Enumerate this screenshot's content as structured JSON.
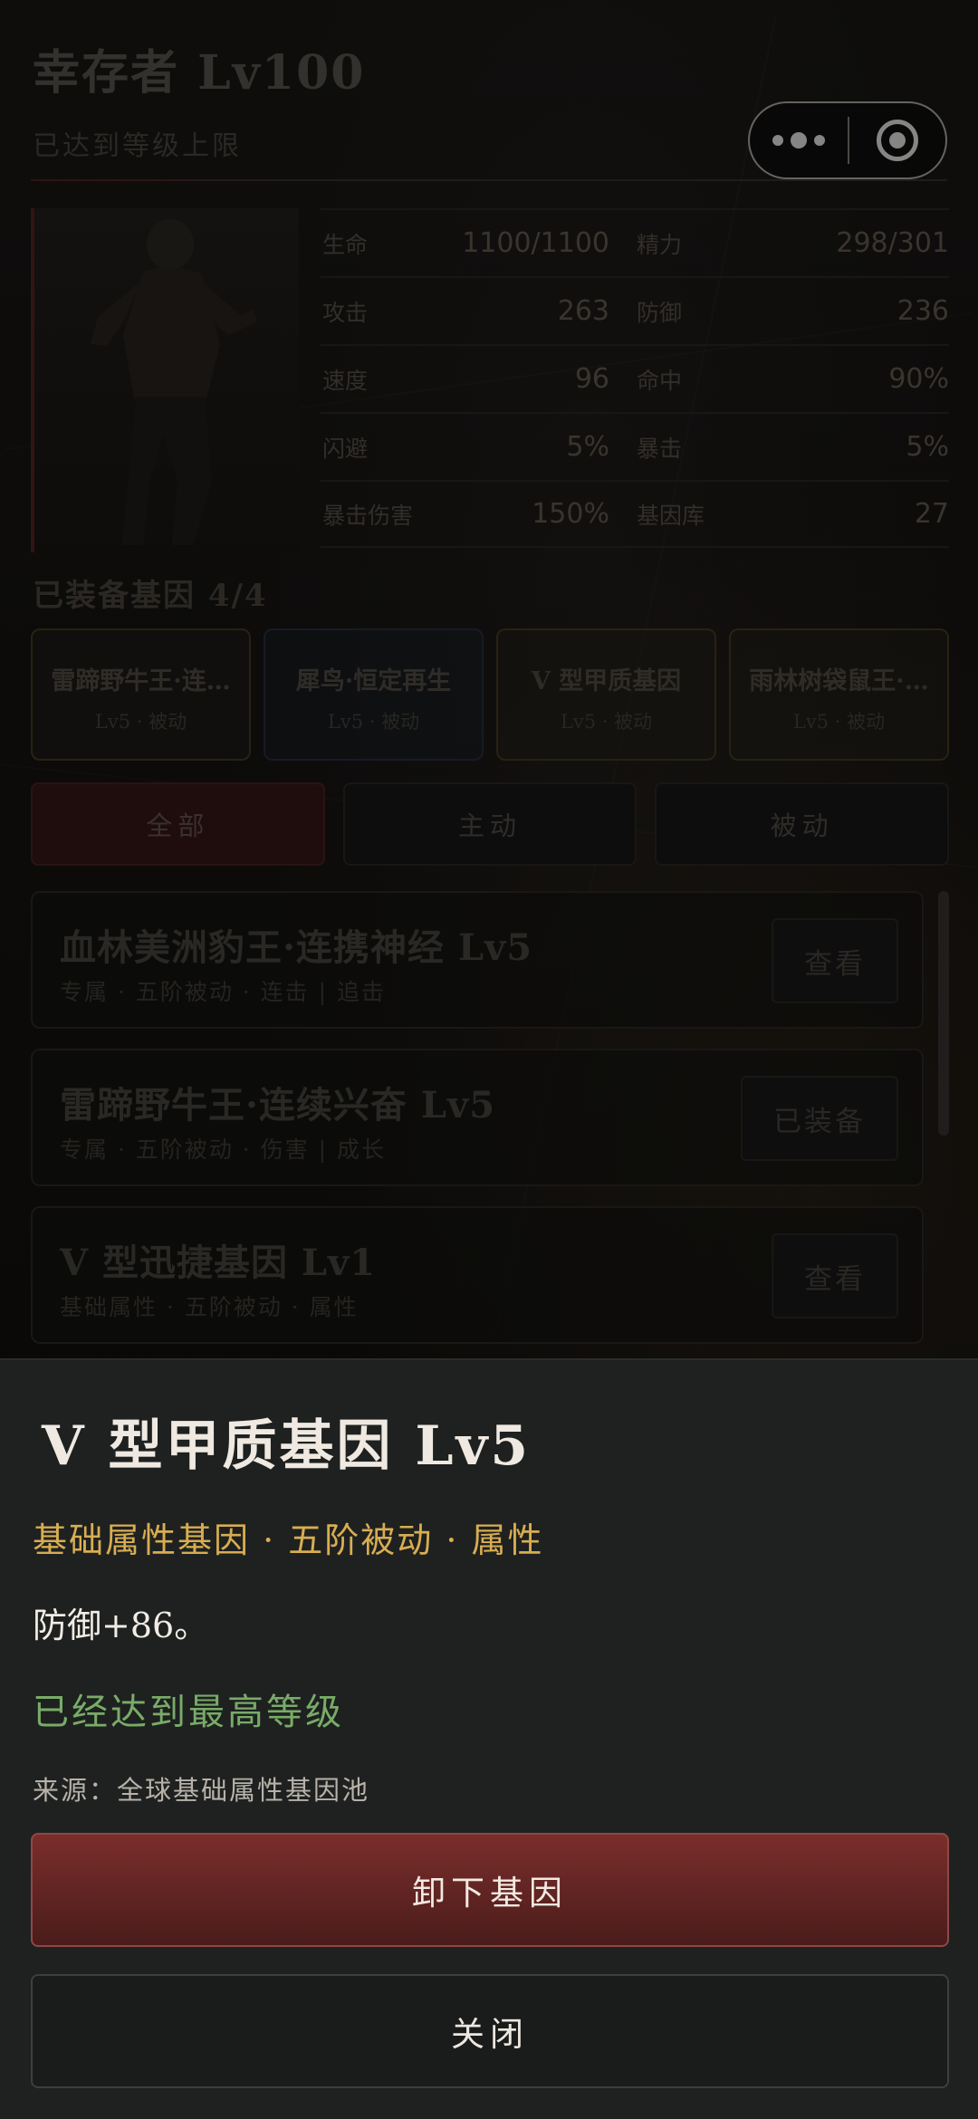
{
  "header": {
    "title": "幸存者 Lv100",
    "subtitle": "已达到等级上限"
  },
  "stats": [
    [
      {
        "label": "生命",
        "value": "1100/1100"
      },
      {
        "label": "精力",
        "value": "298/301"
      }
    ],
    [
      {
        "label": "攻击",
        "value": "263"
      },
      {
        "label": "防御",
        "value": "236"
      }
    ],
    [
      {
        "label": "速度",
        "value": "96"
      },
      {
        "label": "命中",
        "value": "90%"
      }
    ],
    [
      {
        "label": "闪避",
        "value": "5%"
      },
      {
        "label": "暴击",
        "value": "5%"
      }
    ],
    [
      {
        "label": "暴击伤害",
        "value": "150%"
      },
      {
        "label": "基因库",
        "value": "27"
      }
    ]
  ],
  "equipped": {
    "title": "已装备基因 4/4",
    "cards": [
      {
        "name": "雷蹄野牛王·连…",
        "sub": "Lv5 · 被动"
      },
      {
        "name": "犀鸟·恒定再生",
        "sub": "Lv5 · 被动"
      },
      {
        "name": "V 型甲质基因",
        "sub": "Lv5 · 被动"
      },
      {
        "name": "雨林树袋鼠王·…",
        "sub": "Lv5 · 被动"
      }
    ]
  },
  "filters": [
    "全部",
    "主动",
    "被动"
  ],
  "gene_list": [
    {
      "name": "血林美洲豹王·连携神经 Lv5",
      "desc": "专属 · 五阶被动 · 连击 | 追击",
      "action": "查看"
    },
    {
      "name": "雷蹄野牛王·连续兴奋 Lv5",
      "desc": "专属 · 五阶被动 · 伤害 | 成长",
      "action": "已装备"
    },
    {
      "name": "V 型迅捷基因 Lv1",
      "desc": "基础属性 · 五阶被动 · 属性",
      "action": "查看"
    }
  ],
  "sheet": {
    "title": "V 型甲质基因 Lv5",
    "tags": "基础属性基因 · 五阶被动 · 属性",
    "effect": "防御+86。",
    "max_level": "已经达到最高等级",
    "source": "来源：全球基础属性基因池",
    "primary_button": "卸下基因",
    "close_button": "关闭"
  },
  "icons": {
    "capsule_more": "more-dots-icon",
    "capsule_close": "target-close-icon"
  }
}
